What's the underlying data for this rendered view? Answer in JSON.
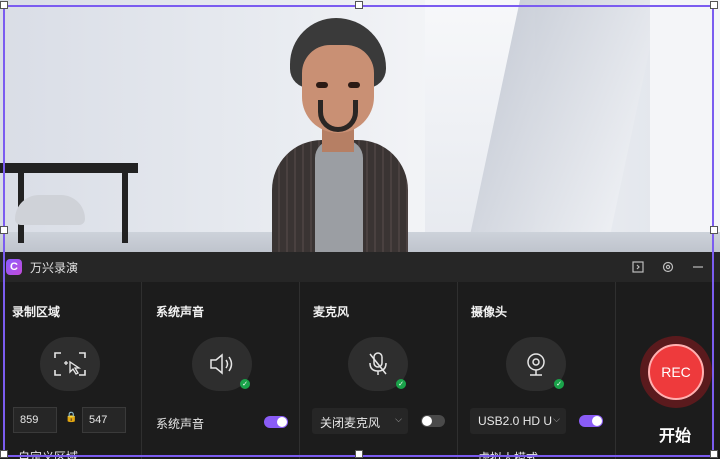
{
  "app": {
    "title": "万兴录演",
    "logo_glyph": "C"
  },
  "toolbar": {
    "icons": [
      "expand-icon",
      "settings-icon",
      "minimize-icon"
    ]
  },
  "sections": {
    "region": {
      "title": "录制区域",
      "width": "859",
      "height": "547",
      "mode_partial": "自定义区域"
    },
    "system_audio": {
      "title": "系统声音",
      "label": "系统声音",
      "enabled": true
    },
    "microphone": {
      "title": "麦克风",
      "selected": "关闭麦克风",
      "enabled": false
    },
    "camera": {
      "title": "摄像头",
      "selected": "USB2.0 HD U",
      "enabled": true,
      "mode_partial": "虚拟人模式"
    }
  },
  "record": {
    "button": "REC",
    "label": "开始"
  },
  "colors": {
    "accent": "#8a5cf6",
    "rec": "#ee3a3c",
    "ok": "#1aa34a"
  }
}
